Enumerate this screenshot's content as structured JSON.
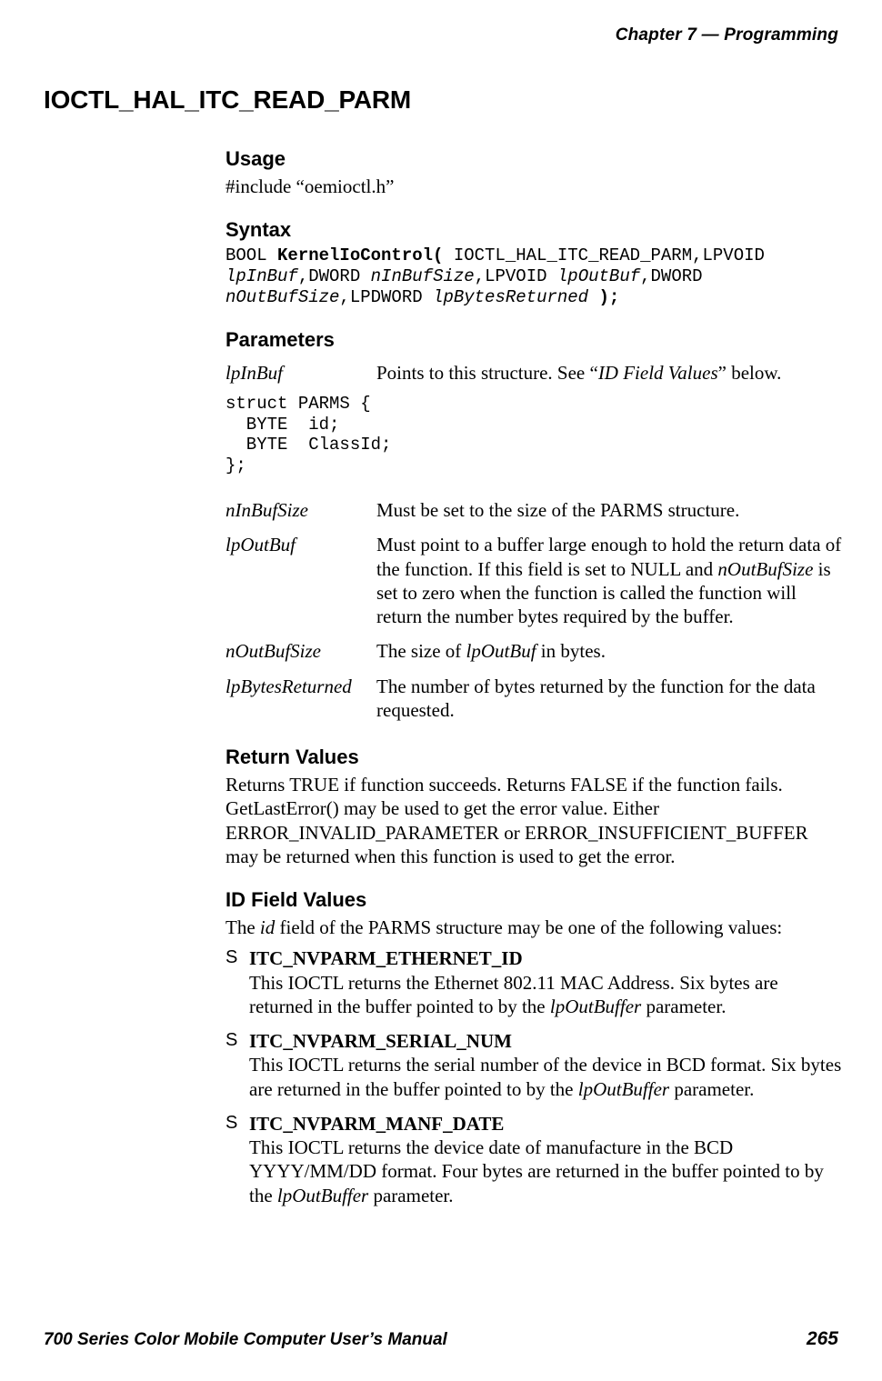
{
  "header": {
    "running_head": "Chapter 7 — Programming"
  },
  "title": "IOCTL_HAL_ITC_READ_PARM",
  "sections": {
    "usage": {
      "h": "Usage",
      "body": "#include “oemioctl.h”"
    },
    "syntax": {
      "h": "Syntax",
      "code_html": "BOOL <b>KernelIoControl(</b> IOCTL_HAL_ITC_READ_PARM,LPVOID\n<i>lpInBuf</i>,DWORD <i>nInBufSize</i>,LPVOID <i>lpOutBuf</i>,DWORD\n<i>nOutBufSize</i>,LPDWORD <i>lpBytesReturned</i> <b>);</b>"
    },
    "parameters": {
      "h": "Parameters",
      "intro_name": "lpInBuf",
      "intro_desc_html": "Points to this structure. See “<i>ID Field Values</i>” below.",
      "code": "struct PARMS {\n  BYTE  id;\n  BYTE  ClassId;\n};",
      "rows": [
        {
          "name": "nInBufSize",
          "desc_html": "Must be set to the size of the PARMS structure."
        },
        {
          "name": "lpOutBuf",
          "desc_html": "Must point to a buffer large enough to hold the return data of the function. If this field is set to NULL and <i>nOutBufSize</i> is set to zero when the function is called the function will return the number bytes required by the buffer."
        },
        {
          "name": "nOutBufSize",
          "desc_html": "The size of <i>lpOutBuf</i> in bytes."
        },
        {
          "name": "lpBytesReturned",
          "desc_html": "The number of bytes returned by the function for the data requested."
        }
      ]
    },
    "return_values": {
      "h": "Return Values",
      "body": "Returns TRUE if function succeeds. Returns FALSE if the function fails. GetLastError() may be used to get the error value. Either ERROR_INVALID_PARAMETER or ERROR_INSUFFICIENT_BUFFER may be returned when this function is used to get the error."
    },
    "id_field_values": {
      "h": "ID Field Values",
      "intro_html": "The <i>id</i> field of the PARMS structure may be one of the following values:",
      "items": [
        {
          "title": "ITC_NVPARM_ETHERNET_ID",
          "desc_html": "This IOCTL returns the Ethernet 802.11 MAC Address. Six bytes are returned in the buffer pointed to by the <i>lpOutBuffer</i> parameter."
        },
        {
          "title": "ITC_NVPARM_SERIAL_NUM",
          "desc_html": "This IOCTL returns the serial number of the device in BCD format. Six bytes are returned in the buffer pointed to by the <i>lpOutBuffer</i> parameter."
        },
        {
          "title": "ITC_NVPARM_MANF_DATE",
          "desc_html": "This IOCTL returns the device date of manufacture in the BCD YYYY/MM/DD format. Four bytes are returned in the buffer pointed to by the <i>lpOutBuffer</i> parameter."
        }
      ]
    }
  },
  "footer": {
    "left": "700 Series Color Mobile Computer User’s Manual",
    "right": "265"
  }
}
